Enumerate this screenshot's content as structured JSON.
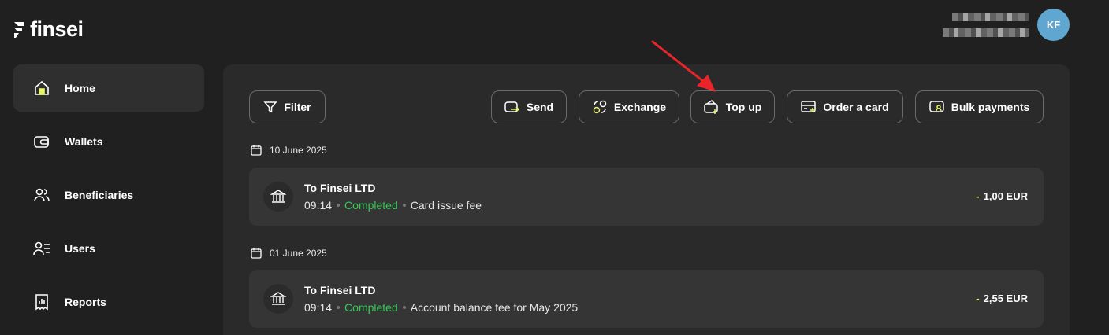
{
  "brand": {
    "name": "finsei"
  },
  "user": {
    "initials": "KF",
    "avatar_color": "#5fa7d1"
  },
  "sidebar": {
    "items": [
      {
        "label": "Home",
        "icon": "home-icon",
        "active": true
      },
      {
        "label": "Wallets",
        "icon": "wallet-icon"
      },
      {
        "label": "Beneficiaries",
        "icon": "users-icon"
      },
      {
        "label": "Users",
        "icon": "user-list-icon"
      },
      {
        "label": "Reports",
        "icon": "report-icon"
      }
    ]
  },
  "toolbar": {
    "filter_label": "Filter",
    "send_label": "Send",
    "exchange_label": "Exchange",
    "topup_label": "Top up",
    "order_card_label": "Order a card",
    "bulk_label": "Bulk payments"
  },
  "transactions": [
    {
      "date": "10 June 2025",
      "title": "To Finsei LTD",
      "time": "09:14",
      "status": "Completed",
      "description": "Card issue fee",
      "sign": "-",
      "amount": "1,00 EUR"
    },
    {
      "date": "01 June 2025",
      "title": "To Finsei LTD",
      "time": "09:14",
      "status": "Completed",
      "description": "Account balance fee for May 2025",
      "sign": "-",
      "amount": "2,55 EUR"
    }
  ],
  "colors": {
    "accent": "#e6f36b",
    "success": "#35c759",
    "annotation": "#e8252b"
  }
}
